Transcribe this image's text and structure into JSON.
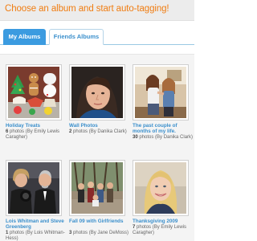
{
  "banner": {
    "text": "Choose an album and start auto-tagging!"
  },
  "tabs": [
    {
      "label": "My Albums",
      "active": true
    },
    {
      "label": "Friends Albums",
      "active": false
    }
  ],
  "albums": [
    {
      "title": "Holiday Treats",
      "count": "6",
      "count_suffix": "photos (By Emily Lewis Caragher)"
    },
    {
      "title": "Wall Photos",
      "count": "2",
      "count_suffix": "photos (By Danika Clark)"
    },
    {
      "title": "The past couple of months of my life.",
      "count": "30",
      "count_suffix": "photos (By Danika Clark)"
    },
    {
      "title": "Lois Whitman and Steve Greenberg",
      "count": "1",
      "count_suffix": "photos (By Lois Whitman-Hess)"
    },
    {
      "title": "Fall 09 with Girlfriends",
      "count": "3",
      "count_suffix": "photos (By Jane DeMoss)"
    },
    {
      "title": "Thanksgiving 2009",
      "count": "7",
      "count_suffix": "photos (By Emily Lewis Caragher)"
    }
  ]
}
